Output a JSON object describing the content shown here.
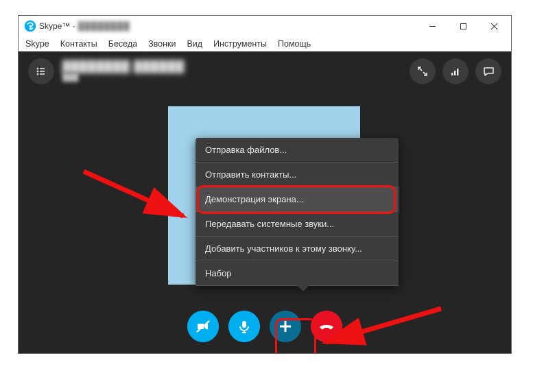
{
  "window": {
    "title_prefix": "Skype™ - ",
    "min_icon": "minimize-icon",
    "max_icon": "maximize-icon",
    "close_icon": "close-icon"
  },
  "menu": {
    "skype": "Skype",
    "contacts": "Контакты",
    "conversation": "Беседа",
    "calls": "Звонки",
    "view": "Вид",
    "tools": "Инструменты",
    "help": "Помощь"
  },
  "top_icons": {
    "participants": "participants-icon",
    "fullscreen": "fullscreen-icon",
    "quality": "signal-icon",
    "chat": "chat-icon"
  },
  "popup": {
    "send_files": "Отправка файлов...",
    "send_contacts": "Отправить контакты...",
    "share_screen": "Демонстрация экрана...",
    "system_sounds": "Передавать системные звуки...",
    "add_people": "Добавить участников к этому звонку...",
    "dialpad": "Набор"
  },
  "controls": {
    "camera": "camera-off-icon",
    "mic": "mic-icon",
    "plus": "plus-icon",
    "hangup": "hangup-icon"
  }
}
